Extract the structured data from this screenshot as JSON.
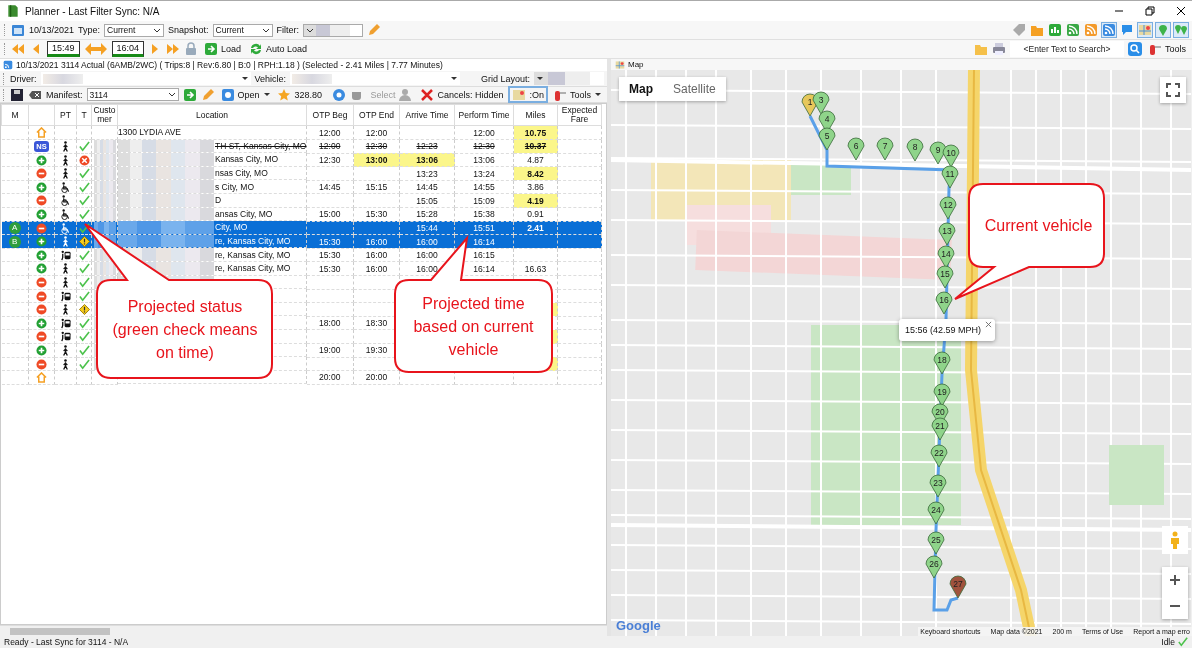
{
  "window": {
    "title": "Planner - Last Filter Sync: N/A"
  },
  "toolbar": {
    "date": "10/13/2021",
    "type_label": "Type:",
    "type_value": "Current",
    "snapshot_label": "Snapshot:",
    "snapshot_value": "Current",
    "filter_label": "Filter:"
  },
  "time_bar": {
    "start": "15:49",
    "end": "16:04",
    "load": "Load",
    "auto_load": "Auto Load"
  },
  "search": {
    "placeholder": "<Enter Text to Search>"
  },
  "tools": "Tools",
  "summary": "10/13/2021 3114 Actual (6AMB/2WC) ( Trips:8  |  Rev:6.80  |  B:0  |  RPH:1.18 ) (Selected - 2.41 Miles  |  7.77 Minutes)",
  "filters": {
    "driver_label": "Driver:",
    "vehicle_label": "Vehicle:",
    "grid_layout_label": "Grid Layout:"
  },
  "manifest_bar": {
    "label": "Manifest:",
    "value": "3114",
    "open": "Open",
    "rating": "328.80",
    "select": "Select",
    "cancels": "Cancels: Hidden",
    "toggle": ":On",
    "tools": "Tools"
  },
  "table": {
    "columns": [
      "M",
      "PT",
      "T",
      "Customer",
      "Location",
      "OTP Beg",
      "OTP End",
      "Arrive Time",
      "Perform Time",
      "Miles",
      "Expected Fare"
    ],
    "rows": [
      {
        "action": {
          "kind": "home"
        },
        "location": "1300 LYDIA AVE",
        "otp_beg": "12:00",
        "otp_end": "12:00",
        "perform": "12:00",
        "miles": "10.75",
        "highlighted": {
          "miles": true
        },
        "selected": false,
        "cancelled": false
      },
      {
        "action": {
          "kind": "noshow",
          "badge": "NS"
        },
        "pt": {
          "kind": "walk"
        },
        "t": {
          "kind": "check"
        },
        "location": "TH ST, Kansas City, MO",
        "otp_beg": "12:00",
        "otp_end": "12:30",
        "arrive": "12:23",
        "perform": "12:30",
        "miles": "10.37",
        "highlighted": {
          "miles": true
        },
        "selected": false,
        "cancelled": true,
        "redacted": true
      },
      {
        "action": {
          "kind": "pickup"
        },
        "pt": {
          "kind": "walk"
        },
        "t": {
          "kind": "late"
        },
        "location": "Kansas City, MO",
        "otp_beg": "12:30",
        "otp_end": "13:00",
        "arrive": "13:06",
        "perform": "13:06",
        "miles": "4.87",
        "highlighted": {
          "otp_end": true,
          "arrive": true
        },
        "selected": false,
        "cancelled": false,
        "redacted": true
      },
      {
        "action": {
          "kind": "dropoff"
        },
        "pt": {
          "kind": "walk"
        },
        "t": {
          "kind": "check"
        },
        "location": "nsas City, MO",
        "arrive": "13:23",
        "perform": "13:24",
        "miles": "8.42",
        "highlighted": {
          "miles": true
        },
        "selected": false,
        "cancelled": false,
        "redacted": true
      },
      {
        "action": {
          "kind": "pickup"
        },
        "pt": {
          "kind": "wheelchair"
        },
        "t": {
          "kind": "check"
        },
        "location": "s City, MO",
        "otp_beg": "14:45",
        "otp_end": "15:15",
        "arrive": "14:45",
        "perform": "14:55",
        "miles": "3.86",
        "selected": false,
        "cancelled": false,
        "redacted": true
      },
      {
        "action": {
          "kind": "dropoff"
        },
        "pt": {
          "kind": "wheelchair"
        },
        "t": {
          "kind": "check"
        },
        "location": "D",
        "arrive": "15:05",
        "perform": "15:09",
        "miles": "4.19",
        "highlighted": {
          "miles": true
        },
        "selected": false,
        "cancelled": false,
        "redacted": true
      },
      {
        "action": {
          "kind": "pickup"
        },
        "pt": {
          "kind": "wheelchair"
        },
        "t": {
          "kind": "check"
        },
        "location": "ansas City, MO",
        "otp_beg": "15:00",
        "otp_end": "15:30",
        "arrive": "15:28",
        "perform": "15:38",
        "miles": "0.91",
        "selected": false,
        "cancelled": false,
        "redacted": true
      },
      {
        "marker": "A",
        "action": {
          "kind": "dropoff"
        },
        "pt": {
          "kind": "wheelchair"
        },
        "t": {
          "kind": "check"
        },
        "location": "City, MO",
        "arrive": "15:44",
        "perform": "15:51",
        "miles": "2.41",
        "highlighted": {
          "miles": true
        },
        "selected": true,
        "cancelled": false,
        "redacted": true
      },
      {
        "marker": "B",
        "action": {
          "kind": "pickup"
        },
        "pt": {
          "kind": "walk"
        },
        "t": {
          "kind": "warning"
        },
        "location": "re, Kansas City, MO",
        "otp_beg": "15:30",
        "otp_end": "16:00",
        "arrive": "16:00",
        "perform": "16:14",
        "selected": true,
        "cancelled": false,
        "redacted": true
      },
      {
        "action": {
          "kind": "pickup"
        },
        "pt": {
          "kind": "bus"
        },
        "t": {
          "kind": "check"
        },
        "location": "re, Kansas City, MO",
        "otp_beg": "15:30",
        "otp_end": "16:00",
        "arrive": "16:00",
        "perform": "16:15",
        "selected": false,
        "cancelled": false,
        "redacted": true
      },
      {
        "action": {
          "kind": "pickup"
        },
        "pt": {
          "kind": "walk"
        },
        "t": {
          "kind": "check"
        },
        "location": "re, Kansas City, MO",
        "otp_beg": "15:30",
        "otp_end": "16:00",
        "arrive": "16:00",
        "perform": "16:14",
        "miles": "16.63",
        "selected": false,
        "cancelled": false,
        "redacted": true
      },
      {
        "action": {
          "kind": "dropoff"
        },
        "pt": {
          "kind": "walk"
        },
        "t": {
          "kind": "check"
        },
        "selected": false,
        "redacted": true
      },
      {
        "action": {
          "kind": "dropoff"
        },
        "pt": {
          "kind": "bus"
        },
        "t": {
          "kind": "check"
        },
        "selected": false,
        "redacted": true
      },
      {
        "action": {
          "kind": "dropoff"
        },
        "pt": {
          "kind": "walk"
        },
        "t": {
          "kind": "warning"
        },
        "highlighted": {
          "miles": true
        },
        "selected": false,
        "redacted": true
      },
      {
        "action": {
          "kind": "pickup"
        },
        "pt": {
          "kind": "bus"
        },
        "t": {
          "kind": "check"
        },
        "otp_beg": "18:00",
        "otp_end": "18:30",
        "selected": false,
        "redacted": true
      },
      {
        "action": {
          "kind": "dropoff"
        },
        "pt": {
          "kind": "bus"
        },
        "t": {
          "kind": "check"
        },
        "highlighted": {
          "miles": true
        },
        "selected": false,
        "redacted": true
      },
      {
        "action": {
          "kind": "pickup"
        },
        "pt": {
          "kind": "walk"
        },
        "t": {
          "kind": "check"
        },
        "otp_beg": "19:00",
        "otp_end": "19:30",
        "selected": false,
        "redacted": true
      },
      {
        "action": {
          "kind": "dropoff"
        },
        "pt": {
          "kind": "walk"
        },
        "t": {
          "kind": "check"
        },
        "highlighted": {
          "miles": true
        },
        "selected": false,
        "redacted": true
      },
      {
        "action": {
          "kind": "home"
        },
        "otp_beg": "20:00",
        "otp_end": "20:00",
        "selected": false
      }
    ]
  },
  "callouts": [
    {
      "text": "Projected status (green check means on time)"
    },
    {
      "text": "Projected time based on current vehicle"
    },
    {
      "text": "Current vehicle"
    }
  ],
  "map": {
    "title": "Map",
    "map_types": [
      {
        "label": "Map",
        "selected": true
      },
      {
        "label": "Satellite",
        "selected": false
      }
    ],
    "pins": [
      {
        "label": "1",
        "color": "#e6c75a"
      },
      {
        "label": "3",
        "color": "#8fd48a"
      },
      {
        "label": "4",
        "color": "#8fd48a"
      },
      {
        "label": "5",
        "color": "#8fd48a"
      },
      {
        "label": "6",
        "color": "#8fd48a"
      },
      {
        "label": "7",
        "color": "#8fd48a"
      },
      {
        "label": "8",
        "color": "#8fd48a"
      },
      {
        "label": "9",
        "color": "#8fd48a"
      },
      {
        "label": "10",
        "color": "#8fd48a"
      },
      {
        "label": "11",
        "color": "#8fd48a"
      },
      {
        "label": "12",
        "color": "#8fd48a"
      },
      {
        "label": "13",
        "color": "#8fd48a"
      },
      {
        "label": "14",
        "color": "#8fd48a"
      },
      {
        "label": "15",
        "color": "#8fd48a"
      },
      {
        "label": "16",
        "color": "#8fd48a"
      },
      {
        "label": "18",
        "color": "#8fd48a"
      },
      {
        "label": "19",
        "color": "#8fd48a"
      },
      {
        "label": "20",
        "color": "#8fd48a"
      },
      {
        "label": "21",
        "color": "#8fd48a"
      },
      {
        "label": "22",
        "color": "#8fd48a"
      },
      {
        "label": "23",
        "color": "#8fd48a"
      },
      {
        "label": "24",
        "color": "#8fd48a"
      },
      {
        "label": "25",
        "color": "#8fd48a"
      },
      {
        "label": "26",
        "color": "#8fd48a"
      },
      {
        "label": "27",
        "color": "#a0523d"
      }
    ],
    "popup": "15:56 (42.59 MPH)",
    "logo": "Google",
    "attribution": [
      "Keyboard shortcuts",
      "Map data ©2021",
      "200 m",
      "Terms of Use",
      "Report a map erro"
    ]
  },
  "status_bar": {
    "text": "Ready - Last Sync for 3114 - N/A",
    "state": "Idle"
  }
}
